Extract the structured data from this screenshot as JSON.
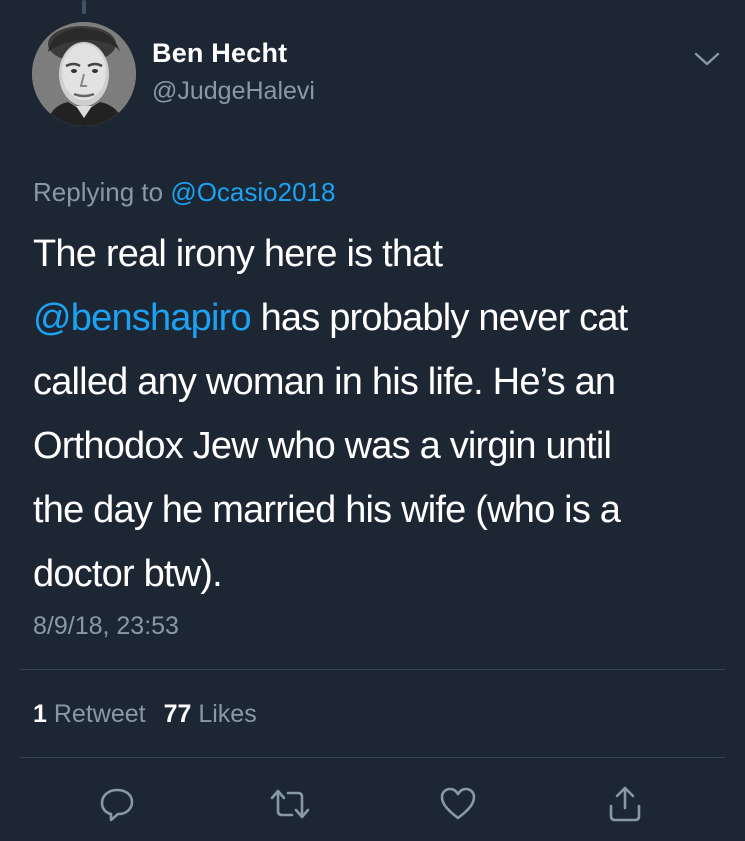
{
  "author": {
    "display_name": "Ben Hecht",
    "handle": "@JudgeHalevi"
  },
  "reply_context": {
    "prefix": "Replying to ",
    "mention": "@Ocasio2018"
  },
  "tweet": {
    "lines": [
      {
        "segments": [
          {
            "text": "The real irony here is that",
            "type": "text"
          }
        ]
      },
      {
        "segments": [
          {
            "text": "@benshapiro",
            "type": "mention"
          },
          {
            "text": " has probably never cat",
            "type": "text"
          }
        ]
      },
      {
        "segments": [
          {
            "text": "called any woman in his life. He’s an",
            "type": "text"
          }
        ]
      },
      {
        "segments": [
          {
            "text": "Orthodox Jew who was a virgin until",
            "type": "text"
          }
        ]
      },
      {
        "segments": [
          {
            "text": "the day he married his wife (who is a",
            "type": "text"
          }
        ]
      },
      {
        "segments": [
          {
            "text": "doctor btw).",
            "type": "text"
          }
        ]
      }
    ],
    "timestamp": "8/9/18, 23:53"
  },
  "stats": {
    "retweet_count": "1",
    "retweet_label": "Retweet",
    "like_count": "77",
    "like_label": "Likes"
  },
  "actions": [
    {
      "name": "reply-button",
      "icon": "reply-icon"
    },
    {
      "name": "retweet-button",
      "icon": "retweet-icon"
    },
    {
      "name": "like-button",
      "icon": "heart-icon"
    },
    {
      "name": "share-button",
      "icon": "share-icon"
    }
  ],
  "colors": {
    "background": "#1c2733",
    "link": "#1da1f2",
    "secondary_text": "#8899a6",
    "divider": "#38444d"
  }
}
